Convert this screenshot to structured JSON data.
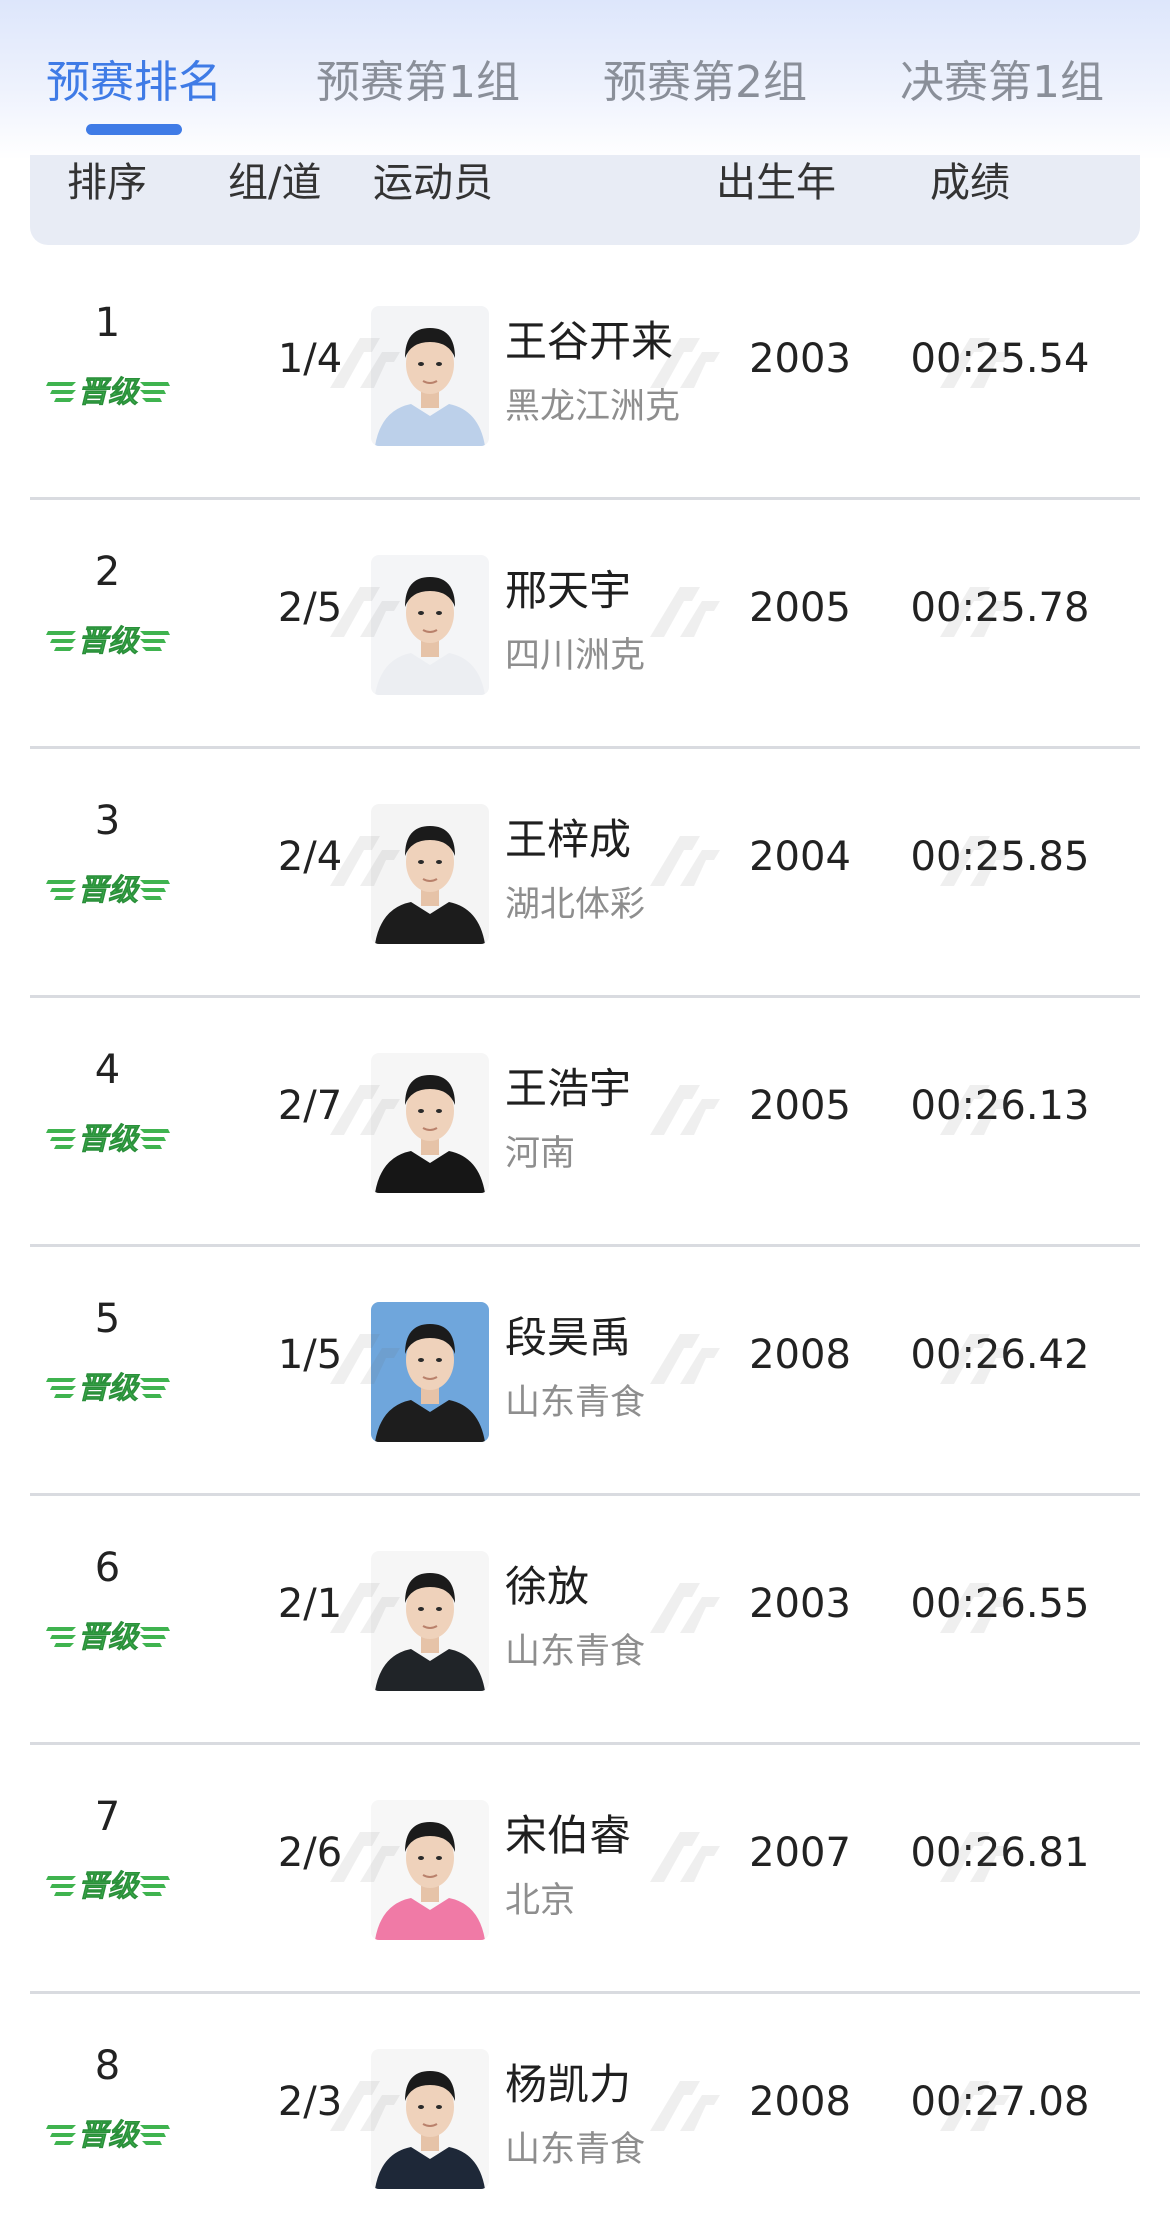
{
  "tabs": [
    {
      "label": "预赛排名",
      "active": true
    },
    {
      "label": "预赛第1组",
      "active": false
    },
    {
      "label": "预赛第2组",
      "active": false
    },
    {
      "label": "决赛第1组",
      "active": false
    }
  ],
  "table": {
    "columns": [
      "排序",
      "组/道",
      "运动员",
      "出生年",
      "成绩"
    ],
    "badge_label": "晋级",
    "rows": [
      {
        "rank": "1",
        "lane": "1/4",
        "name": "王谷开来",
        "team": "黑龙江洲克",
        "year": "2003",
        "time": "00:25.54",
        "shirt": "#bcd0ea",
        "bg": "#f3f4f6"
      },
      {
        "rank": "2",
        "lane": "2/5",
        "name": "邢天宇",
        "team": "四川洲克",
        "year": "2005",
        "time": "00:25.78",
        "shirt": "#eceef2",
        "bg": "#f4f5f7"
      },
      {
        "rank": "3",
        "lane": "2/4",
        "name": "王梓成",
        "team": "湖北体彩",
        "year": "2004",
        "time": "00:25.85",
        "shirt": "#1c1c1c",
        "bg": "#f4f4f4"
      },
      {
        "rank": "4",
        "lane": "2/7",
        "name": "王浩宇",
        "team": "河南",
        "year": "2005",
        "time": "00:26.13",
        "shirt": "#161616",
        "bg": "#f6f6f6"
      },
      {
        "rank": "5",
        "lane": "1/5",
        "name": "段昊禹",
        "team": "山东青食",
        "year": "2008",
        "time": "00:26.42",
        "shirt": "#1d1d1d",
        "bg": "#6fa6dc"
      },
      {
        "rank": "6",
        "lane": "2/1",
        "name": "徐放",
        "team": "山东青食",
        "year": "2003",
        "time": "00:26.55",
        "shirt": "#202428",
        "bg": "#f6f6f6"
      },
      {
        "rank": "7",
        "lane": "2/6",
        "name": "宋伯睿",
        "team": "北京",
        "year": "2007",
        "time": "00:26.81",
        "shirt": "#f07aa6",
        "bg": "#f7f7f7"
      },
      {
        "rank": "8",
        "lane": "2/3",
        "name": "杨凯力",
        "team": "山东青食",
        "year": "2008",
        "time": "00:27.08",
        "shirt": "#1e2838",
        "bg": "#f6f6f6"
      }
    ]
  },
  "colors": {
    "accent": "#3f7be6",
    "badge_green": "#3fb34f",
    "header_bg": "#e8ecf5"
  },
  "icons": {
    "badge": "qualified-badge",
    "photo": "athlete-photo",
    "watermark": "watermark-logo"
  }
}
